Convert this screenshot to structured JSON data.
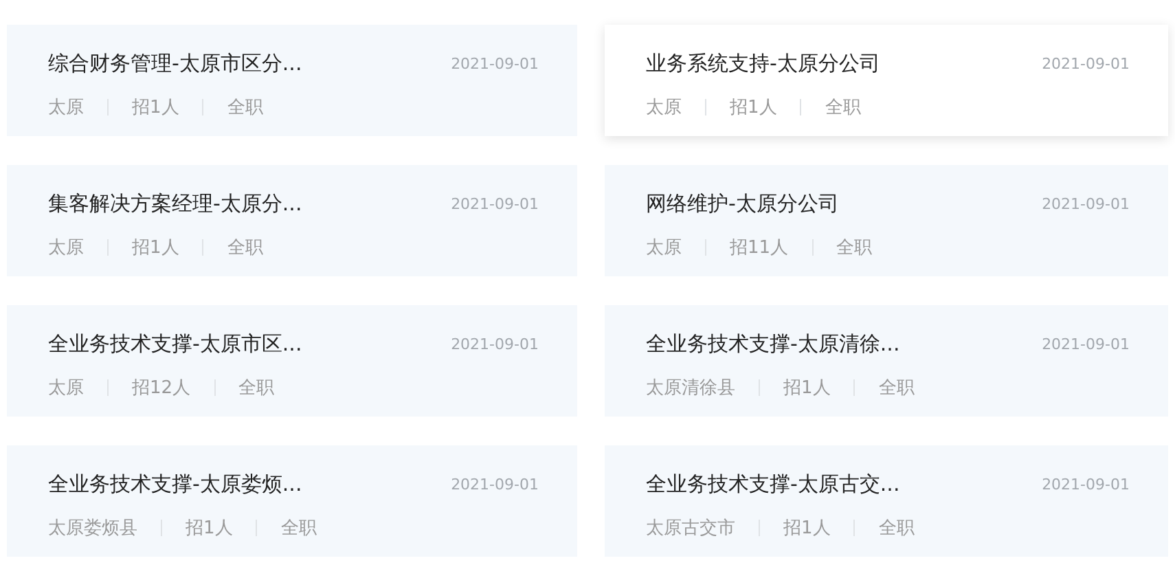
{
  "jobs": [
    {
      "title": "综合财务管理-太原市区分...",
      "date": "2021-09-01",
      "meta": [
        "太原",
        "招1人",
        "全职"
      ],
      "selected": false
    },
    {
      "title": "业务系统支持-太原分公司",
      "date": "2021-09-01",
      "meta": [
        "太原",
        "招1人",
        "全职"
      ],
      "selected": true
    },
    {
      "title": "集客解决方案经理-太原分...",
      "date": "2021-09-01",
      "meta": [
        "太原",
        "招1人",
        "全职"
      ],
      "selected": false
    },
    {
      "title": "网络维护-太原分公司",
      "date": "2021-09-01",
      "meta": [
        "太原",
        "招11人",
        "全职"
      ],
      "selected": false
    },
    {
      "title": "全业务技术支撑-太原市区...",
      "date": "2021-09-01",
      "meta": [
        "太原",
        "招12人",
        "全职"
      ],
      "selected": false
    },
    {
      "title": "全业务技术支撑-太原清徐...",
      "date": "2021-09-01",
      "meta": [
        "太原清徐县",
        "招1人",
        "全职"
      ],
      "selected": false
    },
    {
      "title": "全业务技术支撑-太原娄烦...",
      "date": "2021-09-01",
      "meta": [
        "太原娄烦县",
        "招1人",
        "全职"
      ],
      "selected": false
    },
    {
      "title": "全业务技术支撑-太原古交...",
      "date": "2021-09-01",
      "meta": [
        "太原古交市",
        "招1人",
        "全职"
      ],
      "selected": false
    }
  ]
}
